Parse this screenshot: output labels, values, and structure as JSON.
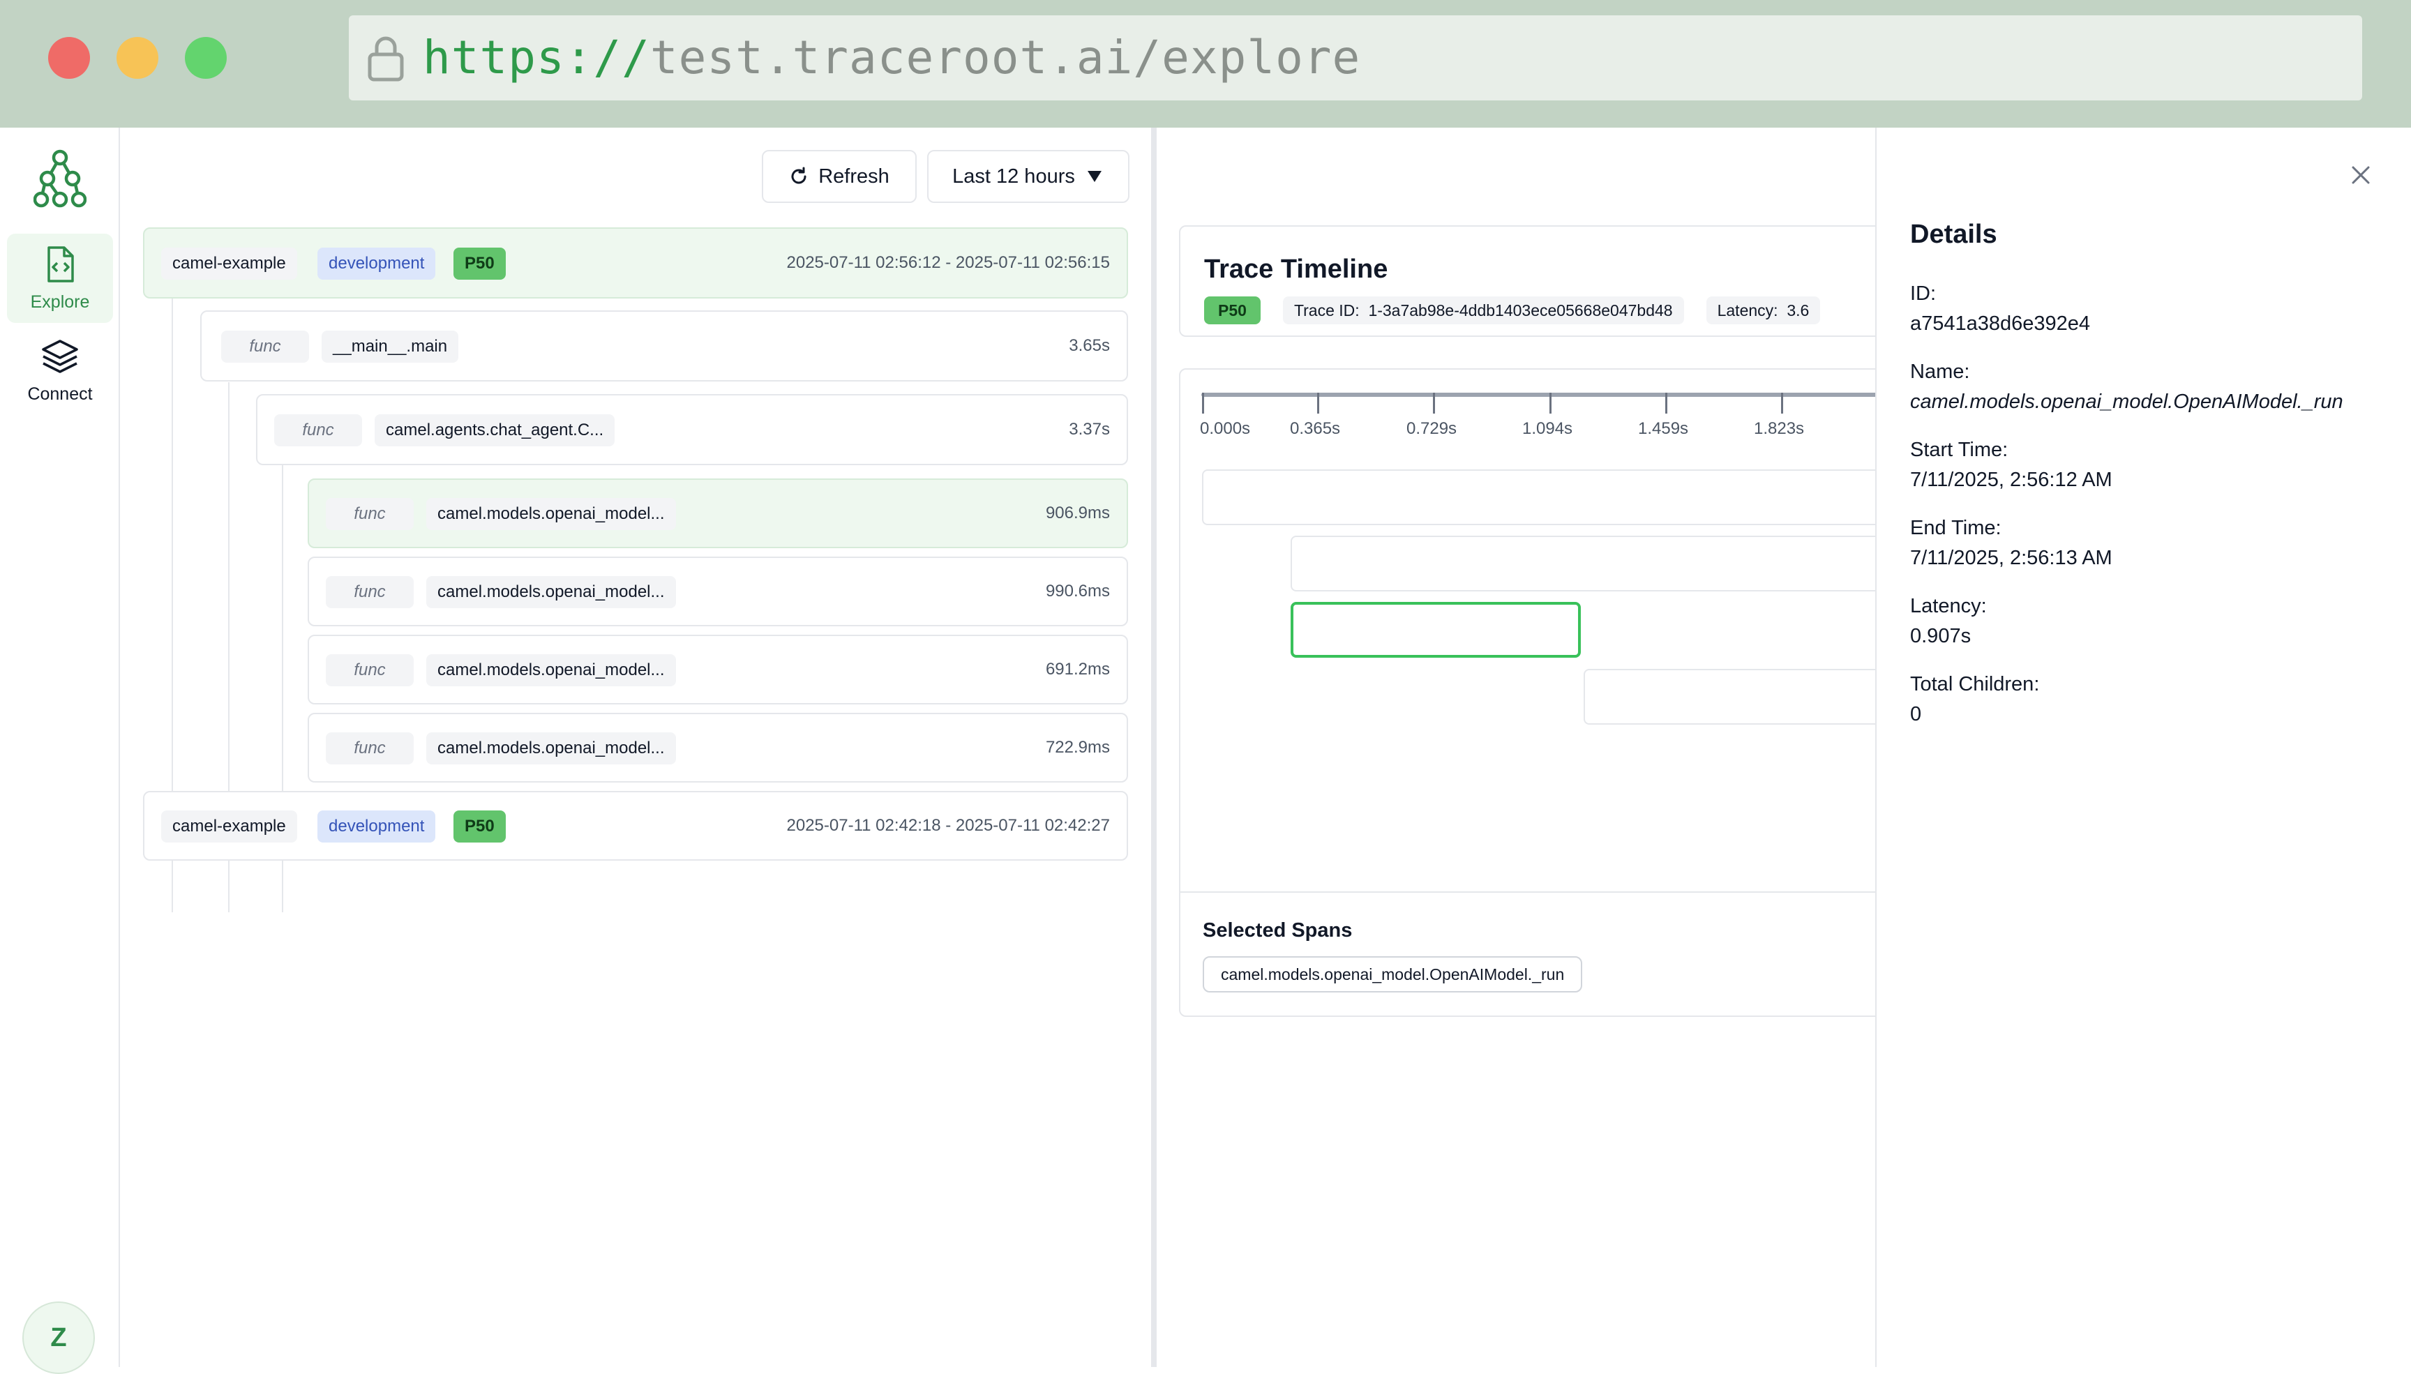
{
  "browser": {
    "url_scheme": "https://",
    "url_host": "test.traceroot.ai/explore"
  },
  "sidebar": {
    "items": [
      {
        "label": "Explore",
        "icon": "file-code-icon",
        "active": true
      },
      {
        "label": "Connect",
        "icon": "layers-icon",
        "active": false
      }
    ],
    "avatar_initial": "Z",
    "accent_color": "#2e8b4a"
  },
  "toolbar": {
    "refresh_label": "Refresh",
    "time_range": "Last 12 hours"
  },
  "traces": [
    {
      "service": "camel-example",
      "environment": "development",
      "percentile": "P50",
      "time_range": "2025-07-11 02:56:12 - 2025-07-11 02:56:15",
      "spans": [
        {
          "kind": "func",
          "name": "__main__.main",
          "duration": "3.65s"
        },
        {
          "kind": "func",
          "name": "camel.agents.chat_agent.C...",
          "duration": "3.37s"
        },
        {
          "kind": "func",
          "name": "camel.models.openai_model...",
          "duration": "906.9ms",
          "selected": true
        },
        {
          "kind": "func",
          "name": "camel.models.openai_model...",
          "duration": "990.6ms"
        },
        {
          "kind": "func",
          "name": "camel.models.openai_model...",
          "duration": "691.2ms"
        },
        {
          "kind": "func",
          "name": "camel.models.openai_model...",
          "duration": "722.9ms"
        }
      ]
    },
    {
      "service": "camel-example",
      "environment": "development",
      "percentile": "P50",
      "time_range": "2025-07-11 02:42:18 - 2025-07-11 02:42:27"
    }
  ],
  "timeline": {
    "title": "Trace Timeline",
    "percentile": "P50",
    "trace_id_label": "Trace ID:",
    "trace_id": "1-3a7ab98e-4ddb1403ece05668e047bd48",
    "latency_label": "Latency:",
    "latency_value": "3.6",
    "ticks": [
      "0.000s",
      "0.365s",
      "0.729s",
      "1.094s",
      "1.459s",
      "1.823s"
    ],
    "selected_spans_title": "Selected Spans",
    "selected_spans": [
      "camel.models.openai_model.OpenAIModel._run"
    ],
    "selected_color": "#39c15a"
  },
  "details": {
    "title": "Details",
    "fields": [
      {
        "label": "ID:",
        "value": "a7541a38d6e392e4"
      },
      {
        "label": "Name:",
        "value": "camel.models.openai_model.OpenAIModel._run"
      },
      {
        "label": "Start Time:",
        "value": "7/11/2025, 2:56:12 AM"
      },
      {
        "label": "End Time:",
        "value": "7/11/2025, 2:56:13 AM"
      },
      {
        "label": "Latency:",
        "value": "0.907s"
      },
      {
        "label": "Total Children:",
        "value": "0"
      }
    ]
  }
}
